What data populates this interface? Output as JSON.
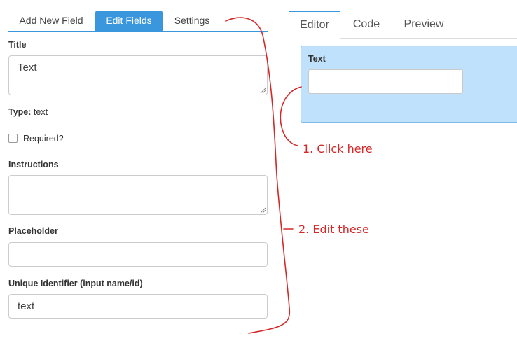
{
  "left_tabs": [
    "Add New Field",
    "Edit Fields",
    "Settings"
  ],
  "form": {
    "title_label": "Title",
    "title_value": "Text",
    "type_label": "Type:",
    "type_value": "text",
    "required_label": "Required?",
    "required_checked": false,
    "instructions_label": "Instructions",
    "instructions_value": "",
    "placeholder_label": "Placeholder",
    "placeholder_value": "",
    "identifier_label": "Unique Identifier (input name/id)",
    "identifier_value": "text"
  },
  "right_tabs": [
    "Editor",
    "Code",
    "Preview"
  ],
  "preview": {
    "field_label": "Text",
    "field_value": ""
  },
  "annotations": {
    "step1": "1. Click here",
    "step2": "2. Edit these",
    "color": "#d42828"
  },
  "colors": {
    "accent": "#3a96dd",
    "preview_bg": "#bfe1fb"
  }
}
